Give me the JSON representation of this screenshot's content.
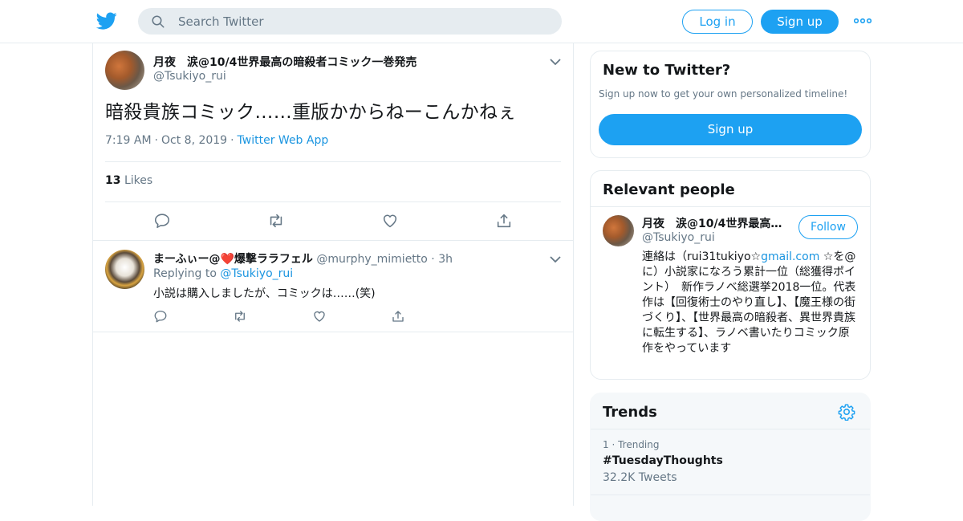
{
  "header": {
    "search_placeholder": "Search Twitter",
    "login_label": "Log in",
    "signup_label": "Sign up"
  },
  "tweet": {
    "author_name": "月夜　涙@10/4世界最高の暗殺者コミック一巻発売",
    "author_handle": "@Tsukiyo_rui",
    "text": "暗殺貴族コミック……重版かからねーこんかねぇ",
    "time": "7:19 AM",
    "date": "Oct 8, 2019",
    "source": "Twitter Web App",
    "likes_count": "13",
    "likes_label": "Likes"
  },
  "reply": {
    "author_name": "まーふぃー@❤️爆撃ララフェル",
    "author_handle": "@murphy_mimietto",
    "time": "3h",
    "replying_to_label": "Replying to",
    "replying_to_handle": "@Tsukiyo_rui",
    "text": "小説は購入しましたが、コミックは……(笑)"
  },
  "sidebar": {
    "new_to_twitter": {
      "title": "New to Twitter?",
      "subtitle": "Sign up now to get your own personalized timeline!",
      "signup_label": "Sign up"
    },
    "relevant_people": {
      "title": "Relevant people",
      "name": "月夜　涙@10/4世界最高…",
      "handle": "@Tsukiyo_rui",
      "follow_label": "Follow",
      "bio_part1": "連絡は（rui31tukiyo☆",
      "bio_link": "gmail.com",
      "bio_part2": " ☆を@に）小説家になろう累計一位（総獲得ポイント）　新作ラノベ総選挙2018一位。代表作は【回復術士のやり直し】、【魔王様の街づくり】、【世界最高の暗殺者、異世界貴族に転生する】、ラノベ書いたりコミック原作をやっています"
    },
    "trends": {
      "title": "Trends",
      "items": [
        {
          "rank": "1",
          "context": "Trending",
          "tag": "#TuesdayThoughts",
          "count": "32.2K Tweets"
        }
      ]
    }
  },
  "colors": {
    "brand": "#1da1f2",
    "link": "#1b95e0",
    "secondary_text": "#657786",
    "border": "#e6ecf0"
  }
}
